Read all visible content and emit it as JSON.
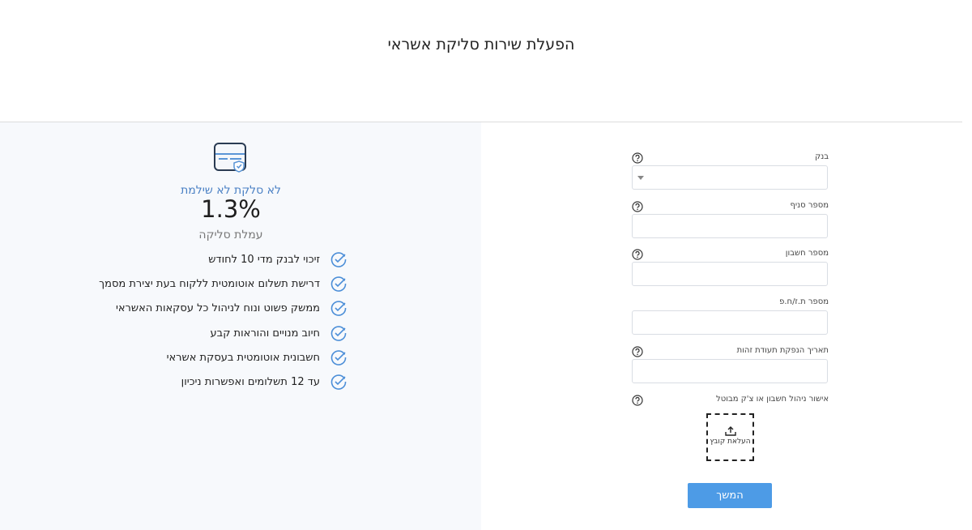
{
  "page": {
    "title": "הפעלת שירות סליקת אשראי"
  },
  "promo": {
    "subtitle": "לא סלקת לא שילמת",
    "rate": "1.3%",
    "rate_label": "עמלת סליקה",
    "features": [
      "זיכוי לבנק מדי 10 לחודש",
      "דרישת תשלום אוטומטית ללקוח בעת יצירת מסמך",
      "ממשק פשוט ונוח לניהול כל עסקאות האשראי",
      "חיוב מנויים והוראות קבע",
      "חשבונית אוטומטית בעסקת אשראי",
      "עד 12 תשלומים ואפשרות ניכיון"
    ]
  },
  "form": {
    "bank_label": "בנק",
    "branch_label": "מספר סניף",
    "account_label": "מספר חשבון",
    "id_label": "מספר ת.ז/ח.פ",
    "id_issue_label": "תאריך הנפקת תעודת זהות",
    "bank_confirmation_label": "אישור ניהול חשבון או צ'ק מבוטל",
    "upload_label": "העלאת קובץ",
    "next_label": "המשך"
  },
  "colors": {
    "accent": "#4d9be6",
    "subtitle": "#4a80c4",
    "panel_bg": "#f7f9fc"
  }
}
